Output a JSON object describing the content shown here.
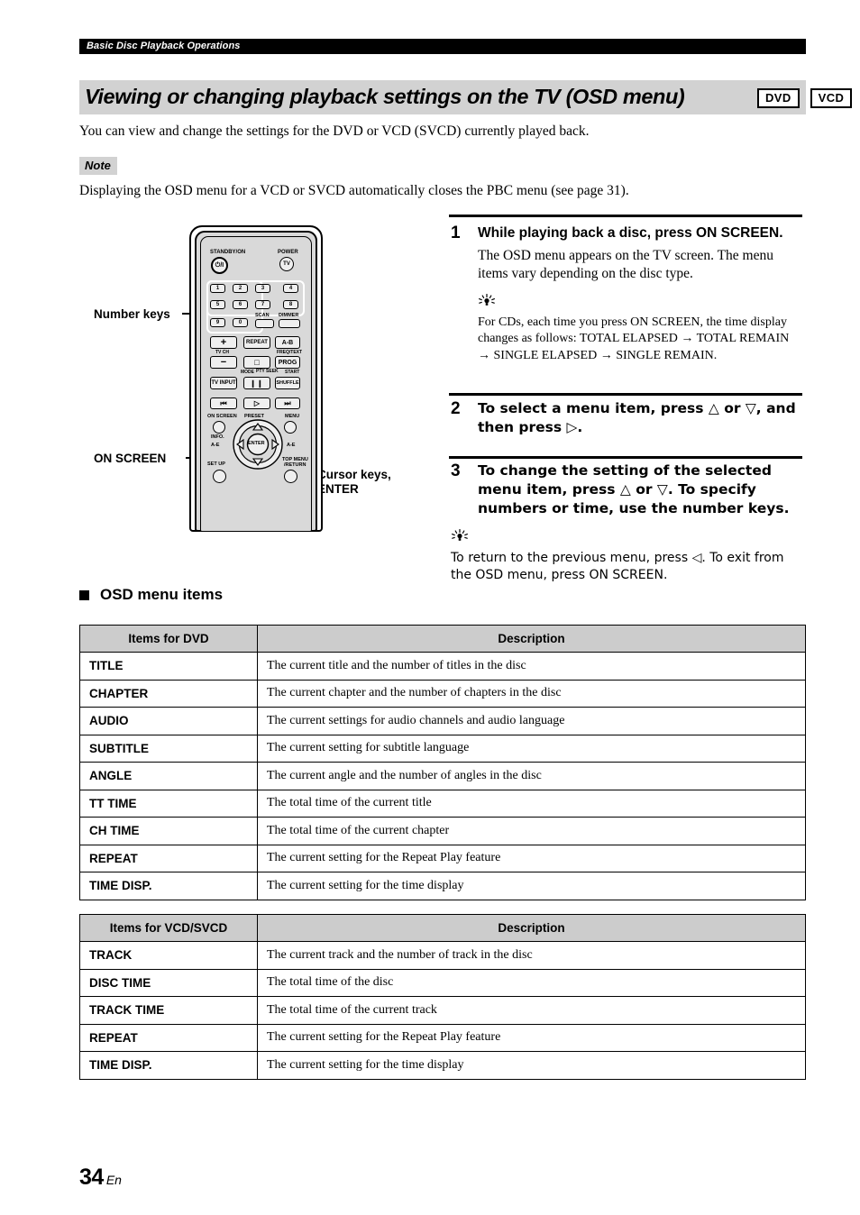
{
  "running_head": "Basic Disc Playback Operations",
  "title": {
    "heading": "Viewing or changing playback settings on the TV (OSD menu)",
    "badges": [
      "DVD",
      "VCD"
    ]
  },
  "intro": "You can view and change the settings for the DVD or VCD (SVCD) currently played back.",
  "note": {
    "label": "Note",
    "text": "Displaying the OSD menu for a VCD or SVCD automatically closes the PBC menu (see page 31)."
  },
  "figure": {
    "callouts": {
      "number_keys": "Number keys",
      "on_screen": "ON SCREEN",
      "cursor_keys_line1": "Cursor keys,",
      "cursor_keys_line2": "ENTER"
    },
    "remote": {
      "standby_label": "STANDBY/ON",
      "standby_glyph": "⏻/I",
      "power_label": "POWER",
      "power_button": "TV",
      "number_keys": [
        "1",
        "2",
        "3",
        "4",
        "5",
        "6",
        "7",
        "8",
        "9",
        "0"
      ],
      "scan_label": "SCAN",
      "dimmer_label": "DIMMER",
      "plus_button": "+",
      "repeat_button": "REPEAT",
      "ab_button": "A-B",
      "tv_ch_label": "TV CH",
      "freq_text_label": "FREQ/TEXT",
      "minus_button": "−",
      "stop_button": "□",
      "prog_button": "PROG",
      "mode_label": "MODE",
      "pty_seek_label": "PTY SEEK",
      "start_label": "START",
      "tv_input_button": "TV INPUT",
      "pause_button": "❙❙",
      "shuffle_button": "SHUFFLE",
      "prev_button": "⏮",
      "play_button": "▷",
      "next_button": "⏭",
      "on_screen_label": "ON SCREEN",
      "info_label": "INFO.",
      "preset_label": "PRESET",
      "menu_label": "MENU",
      "enter_button": "ENTER",
      "ae_left_label": "A-E",
      "ae_right_label": "A-E",
      "setup_label": "SET UP",
      "top_menu_label": "TOP MENU",
      "return_label": "/RETURN"
    }
  },
  "steps": [
    {
      "num": "1",
      "head": "While playing back a disc, press ON SCREEN.",
      "body": "The OSD menu appears on the TV screen. The menu items vary depending on the disc type.",
      "tip": "For CDs, each time you press ON SCREEN, the time display changes as follows: TOTAL ELAPSED → TOTAL REMAIN → SINGLE ELAPSED → SINGLE REMAIN."
    },
    {
      "num": "2",
      "head": "To select a menu item, press △ or ▽, and then press ▷."
    },
    {
      "num": "3",
      "head": "To change the setting of the selected menu item, press △ or ▽. To specify numbers or time, use the number keys.",
      "tip": "To return to the previous menu, press ◁. To exit from the OSD menu, press ON SCREEN."
    }
  ],
  "section_heading": "OSD menu items",
  "table_dvd": {
    "headers": [
      "Items for DVD",
      "Description"
    ],
    "rows": [
      {
        "item": "TITLE",
        "desc": "The current title and the number of titles in the disc"
      },
      {
        "item": "CHAPTER",
        "desc": "The current chapter and the number of chapters in the disc"
      },
      {
        "item": "AUDIO",
        "desc": "The current settings for audio channels and audio language"
      },
      {
        "item": "SUBTITLE",
        "desc": "The current setting for subtitle language"
      },
      {
        "item": "ANGLE",
        "desc": "The current angle and the number of angles in the disc"
      },
      {
        "item": "TT TIME",
        "desc": "The total time of the current title"
      },
      {
        "item": "CH TIME",
        "desc": "The total time of the current chapter"
      },
      {
        "item": "REPEAT",
        "desc": "The current setting for the Repeat Play feature"
      },
      {
        "item": "TIME DISP.",
        "desc": "The current setting for the time display"
      }
    ]
  },
  "table_vcd": {
    "headers": [
      "Items for VCD/SVCD",
      "Description"
    ],
    "rows": [
      {
        "item": "TRACK",
        "desc": "The current track and the number of track in the disc"
      },
      {
        "item": "DISC TIME",
        "desc": "The total time of the disc"
      },
      {
        "item": "TRACK TIME",
        "desc": "The total time of the current track"
      },
      {
        "item": "REPEAT",
        "desc": "The current setting for the Repeat Play feature"
      },
      {
        "item": "TIME DISP.",
        "desc": "The current setting for the time display"
      }
    ]
  },
  "footer": {
    "page_number": "34",
    "language": "En"
  },
  "colors": {
    "band": "#d2d2d2",
    "table_header": "#cccccc",
    "remote_face": "#d9d9d9",
    "ink": "#000000"
  }
}
